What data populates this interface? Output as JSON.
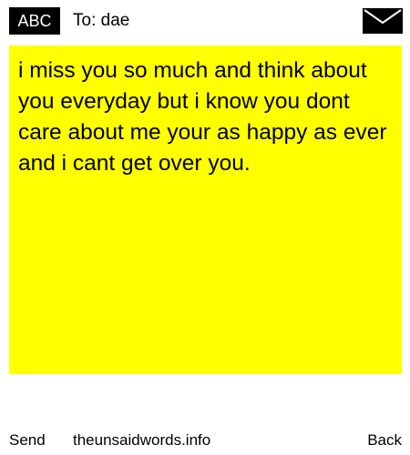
{
  "header": {
    "mode_label": "ABC",
    "recipient": "To: dae",
    "envelope_icon": "envelope-icon"
  },
  "message": {
    "text": "i miss you so much and think about you everyday but i know you dont care about me your as happy as ever and i cant get over you.",
    "background_color": "#ffff00"
  },
  "footer": {
    "send_label": "Send",
    "site_label": "theunsaidwords.info",
    "back_label": "Back"
  }
}
